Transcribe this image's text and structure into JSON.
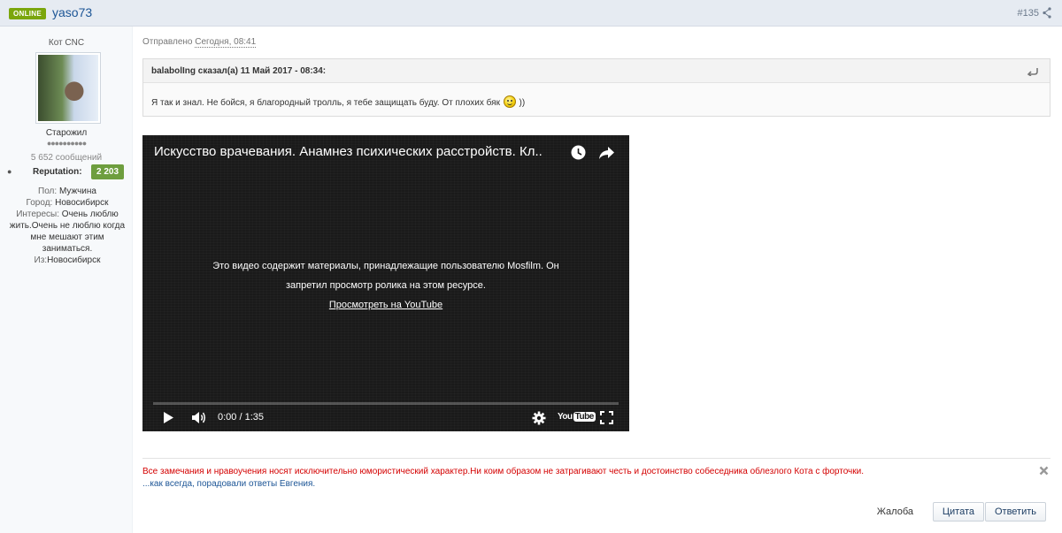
{
  "header": {
    "online_badge": "ONLINE",
    "author": "yaso73",
    "post_number": "#135",
    "share_icon": "share-icon"
  },
  "author_panel": {
    "title": "Кот CNC",
    "rank": "Старожил",
    "pips": "●●●●●●●●●●",
    "post_count": "5 652 сообщений",
    "reputation_label": "Reputation:",
    "reputation_value": "2 203",
    "reputation_color": "#6e9e3e",
    "fields": {
      "gender_key": "Пол:",
      "gender_val": "Мужчина",
      "city_key": "Город:",
      "city_val": "Новосибирск",
      "interests_key": "Интересы:",
      "interests_val": "Очень люблю жить.Очень не люблю когда мне мешают этим заниматься.",
      "from_key": "Из:",
      "from_val": "Новосибирск"
    }
  },
  "post": {
    "sent_label": "Отправлено",
    "sent_time": "Сегодня, 08:41",
    "quote": {
      "citation": "balabolIng сказал(а) 11 Май 2017 - 08:34:",
      "text_before": "Я так и знал. Не бойся, я благородный тролль, я тебе защищать буду. От плохих бяк",
      "text_after": "))"
    },
    "video": {
      "title": "Искусство врачевания. Анамнез психических расстройств. Кл..",
      "message_line1": "Это видео содержит материалы, принадлежащие пользователю Mosfilm. Он",
      "message_line2": "запретил просмотр ролика на этом ресурсе.",
      "watch_link": "Просмотреть на YouTube",
      "time": "0:00 / 1:35",
      "yt_you": "You",
      "yt_tube": "Tube"
    },
    "signature": {
      "line1": "Все замечания и нравоучения носят исключительно юмористический характер.Ни коим образом не затрагивают честь и достоинство собеседника облезлого Кота с форточки.",
      "line2": "...как всегда, порадовали ответы Евгения."
    },
    "actions": {
      "report": "Жалоба",
      "quote": "Цитата",
      "reply": "Ответить"
    }
  },
  "colors": {
    "header_bg": "#e6ebf2",
    "link_blue": "#1c5596",
    "signature_red": "#d40000",
    "online_green": "#7ba60d"
  }
}
